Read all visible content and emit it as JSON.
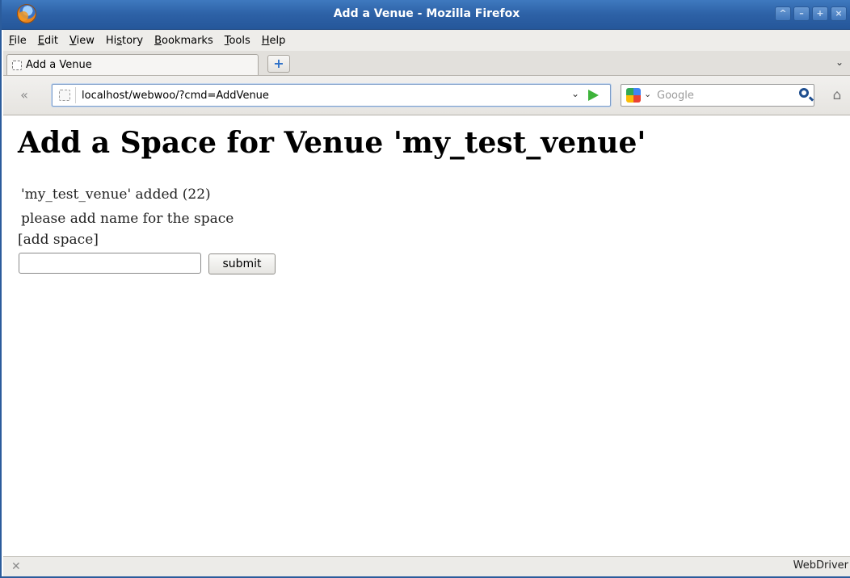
{
  "window": {
    "title": "Add a Venue - Mozilla Firefox",
    "controls": [
      "^",
      "–",
      "+",
      "×"
    ]
  },
  "menu": {
    "items": [
      {
        "label_u": "F",
        "label_rest": "ile"
      },
      {
        "label_u": "E",
        "label_rest": "dit"
      },
      {
        "label_u": "V",
        "label_rest": "iew"
      },
      {
        "label_pre": "Hi",
        "label_u": "s",
        "label_rest": "tory"
      },
      {
        "label_u": "B",
        "label_rest": "ookmarks"
      },
      {
        "label_u": "T",
        "label_rest": "ools"
      },
      {
        "label_u": "H",
        "label_rest": "elp"
      }
    ]
  },
  "tabs": {
    "active_label": "Add a Venue",
    "new_tab_glyph": "+",
    "list_glyph": "⌄"
  },
  "navigation": {
    "back_glyph": "«",
    "url": "localhost/webwoo/?cmd=AddVenue",
    "url_dropdown_glyph": "⌄",
    "search_placeholder": "Google",
    "engine_chevron": "⌄",
    "home_glyph": "⌂"
  },
  "page": {
    "heading": "Add a Space for Venue 'my_test_venue'",
    "added_message": "'my_test_venue' added (22)",
    "instruction": "please add name for the space",
    "form_label": "[add space]",
    "space_name_value": "",
    "submit_label": "submit"
  },
  "status": {
    "close_glyph": "✕",
    "right_text": "WebDriver"
  }
}
